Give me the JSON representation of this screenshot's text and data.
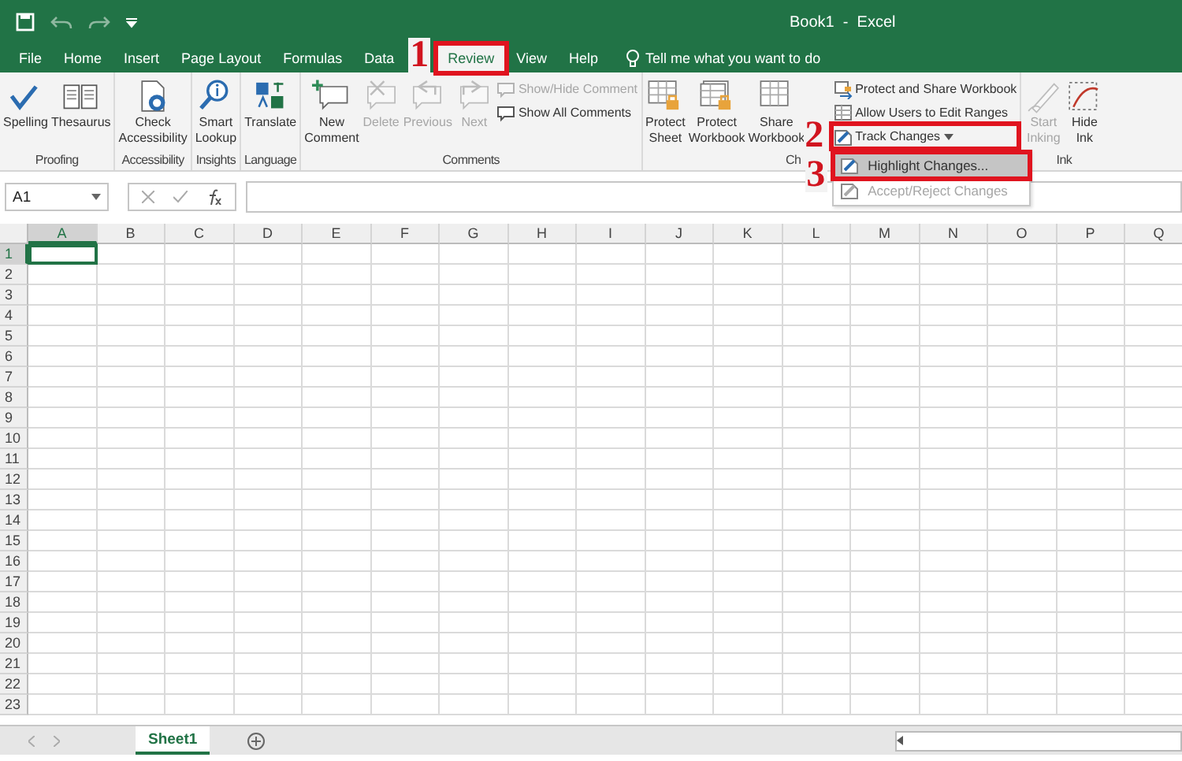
{
  "window": {
    "title": "Book1  -  Excel"
  },
  "tabs": [
    {
      "label": "File",
      "selected": false
    },
    {
      "label": "Home",
      "selected": false
    },
    {
      "label": "Insert",
      "selected": false
    },
    {
      "label": "Page Layout",
      "selected": false
    },
    {
      "label": "Formulas",
      "selected": false
    },
    {
      "label": "Data",
      "selected": false
    },
    {
      "label": "Review",
      "selected": true
    },
    {
      "label": "View",
      "selected": false
    },
    {
      "label": "Help",
      "selected": false
    }
  ],
  "tell_me": {
    "placeholder": "Tell me what you want to do"
  },
  "ribbon_groups": [
    {
      "label": "Proofing",
      "items": [
        {
          "kind": "large",
          "label": "Spelling",
          "disabled": false
        },
        {
          "kind": "large",
          "label": "Thesaurus",
          "disabled": false
        }
      ]
    },
    {
      "label": "Accessibility",
      "items": [
        {
          "kind": "large",
          "label": "Check Accessibility",
          "disabled": false
        }
      ]
    },
    {
      "label": "Insights",
      "items": [
        {
          "kind": "large",
          "label": "Smart Lookup",
          "disabled": false
        }
      ]
    },
    {
      "label": "Language",
      "items": [
        {
          "kind": "large",
          "label": "Translate",
          "disabled": false
        }
      ]
    },
    {
      "label": "Comments",
      "items": [
        {
          "kind": "large",
          "label": "New Comment",
          "disabled": false
        },
        {
          "kind": "large",
          "label": "Delete",
          "disabled": true
        },
        {
          "kind": "large",
          "label": "Previous",
          "disabled": true
        },
        {
          "kind": "large",
          "label": "Next",
          "disabled": true
        },
        {
          "kind": "small",
          "label": "Show/Hide Comment",
          "disabled": true
        },
        {
          "kind": "small",
          "label": "Show All Comments",
          "disabled": false
        }
      ]
    },
    {
      "label": "Ch",
      "items": [
        {
          "kind": "large",
          "label": "Protect Sheet",
          "disabled": false
        },
        {
          "kind": "large",
          "label": "Protect Workbook",
          "disabled": false
        },
        {
          "kind": "large",
          "label": "Share Workbook",
          "disabled": false
        },
        {
          "kind": "small",
          "label": "Protect and Share Workbook",
          "disabled": false
        },
        {
          "kind": "small",
          "label": "Allow Users to Edit Ranges",
          "disabled": false
        },
        {
          "kind": "dropdown",
          "label": "Track Changes",
          "disabled": false
        }
      ]
    },
    {
      "label": "Ink",
      "items": [
        {
          "kind": "large",
          "label": "Start Inking",
          "disabled": true
        },
        {
          "kind": "large",
          "label": "Hide Ink",
          "disabled": false
        }
      ]
    }
  ],
  "track_changes_menu": [
    {
      "label": "Highlight Changes...",
      "selected": true,
      "disabled": false
    },
    {
      "label": "Accept/Reject Changes",
      "selected": false,
      "disabled": true
    }
  ],
  "name_box": {
    "value": "A1"
  },
  "grid": {
    "columns": [
      {
        "label": "A",
        "selected": true
      },
      {
        "label": "B",
        "selected": false
      },
      {
        "label": "C",
        "selected": false
      },
      {
        "label": "D",
        "selected": false
      },
      {
        "label": "E",
        "selected": false
      },
      {
        "label": "F",
        "selected": false
      },
      {
        "label": "G",
        "selected": false
      },
      {
        "label": "H",
        "selected": false
      },
      {
        "label": "I",
        "selected": false
      },
      {
        "label": "J",
        "selected": false
      },
      {
        "label": "K",
        "selected": false
      },
      {
        "label": "L",
        "selected": false
      },
      {
        "label": "M",
        "selected": false
      },
      {
        "label": "N",
        "selected": false
      },
      {
        "label": "O",
        "selected": false
      },
      {
        "label": "P",
        "selected": false
      },
      {
        "label": "Q",
        "selected": false
      }
    ],
    "rows": [
      {
        "label": "1",
        "selected": true
      },
      {
        "label": "2",
        "selected": false
      },
      {
        "label": "3",
        "selected": false
      },
      {
        "label": "4",
        "selected": false
      },
      {
        "label": "5",
        "selected": false
      },
      {
        "label": "6",
        "selected": false
      },
      {
        "label": "7",
        "selected": false
      },
      {
        "label": "8",
        "selected": false
      },
      {
        "label": "9",
        "selected": false
      },
      {
        "label": "10",
        "selected": false
      },
      {
        "label": "11",
        "selected": false
      },
      {
        "label": "12",
        "selected": false
      },
      {
        "label": "13",
        "selected": false
      },
      {
        "label": "14",
        "selected": false
      },
      {
        "label": "15",
        "selected": false
      },
      {
        "label": "16",
        "selected": false
      },
      {
        "label": "17",
        "selected": false
      },
      {
        "label": "18",
        "selected": false
      },
      {
        "label": "19",
        "selected": false
      },
      {
        "label": "20",
        "selected": false
      },
      {
        "label": "21",
        "selected": false
      },
      {
        "label": "22",
        "selected": false
      },
      {
        "label": "23",
        "selected": false
      }
    ]
  },
  "sheet_tabs": [
    {
      "label": "Sheet1",
      "selected": true
    }
  ],
  "annotations": [
    {
      "text": "1"
    },
    {
      "text": "2"
    },
    {
      "text": "3"
    }
  ]
}
